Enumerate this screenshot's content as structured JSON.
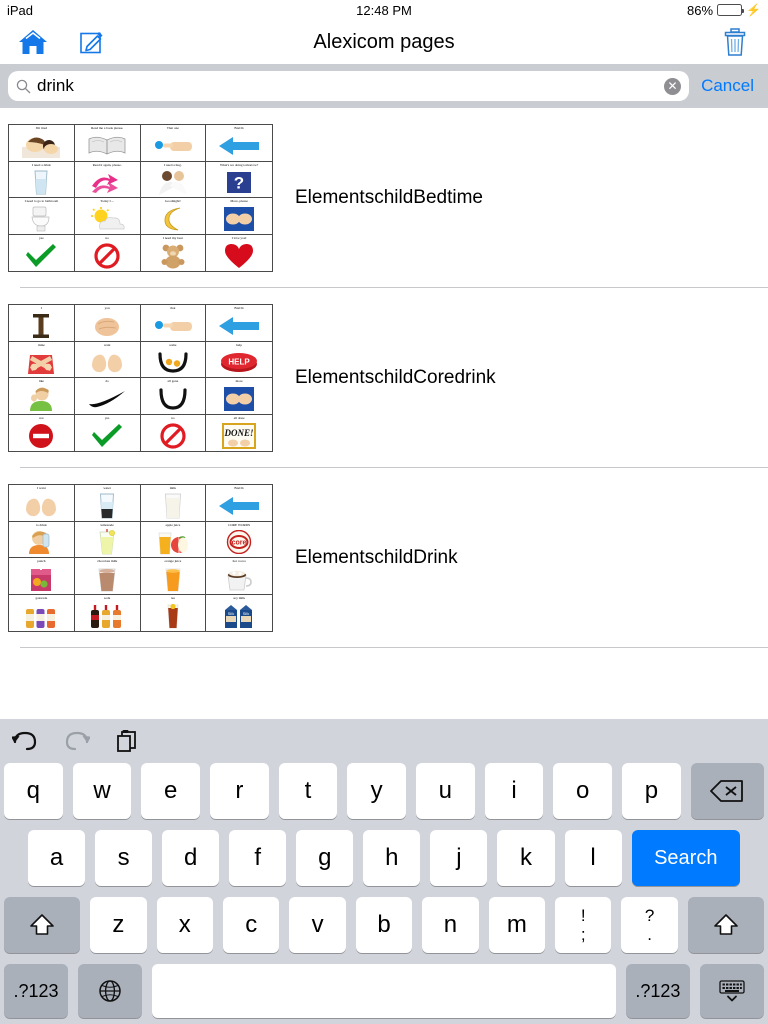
{
  "status_bar": {
    "device": "iPad",
    "time": "12:48 PM",
    "battery_percent": "86%",
    "battery_level": 86,
    "charging": true
  },
  "nav_bar": {
    "title": "Alexicom pages",
    "home_icon": "home-icon",
    "compose_icon": "compose-icon",
    "trash_icon": "trash-icon",
    "icon_color": "#1478e8"
  },
  "search": {
    "value": "drink",
    "placeholder": "Search",
    "icon": "search-icon",
    "clear_label": "✕",
    "cancel_label": "Cancel",
    "cancel_color": "#007aff",
    "bar_background": "#c9ccd1"
  },
  "results": [
    {
      "title": "ElementschildBedtime",
      "cells": [
        {
          "label": "I'm tired",
          "art": "child-sleeping"
        },
        {
          "label": "Read me a book please.",
          "art": "book"
        },
        {
          "label": "That one",
          "art": "pointing-hand"
        },
        {
          "label": "BACK",
          "art": "back-arrow"
        },
        {
          "label": "I need a drink",
          "art": "glass-water"
        },
        {
          "label": "Read it again, please.",
          "art": "pink-arrows"
        },
        {
          "label": "I need a hug.",
          "art": "hug"
        },
        {
          "label": "What's we doing tomorrow?",
          "art": "question-cube"
        },
        {
          "label": "I need to go to bathroom",
          "art": "toilet"
        },
        {
          "label": "Today I ...",
          "art": "sun-cloud"
        },
        {
          "label": "Goodnight!",
          "art": "moon"
        },
        {
          "label": "More, please",
          "art": "more-hands"
        },
        {
          "label": "yes",
          "art": "green-check"
        },
        {
          "label": "no",
          "art": "no-sign"
        },
        {
          "label": "I need my bear",
          "art": "teddy-bear"
        },
        {
          "label": "I love you!",
          "art": "red-heart"
        }
      ]
    },
    {
      "title": "ElementschildCoredrink",
      "cells": [
        {
          "label": "I",
          "art": "letter-i"
        },
        {
          "label": "you",
          "art": "pointing-fist"
        },
        {
          "label": "that",
          "art": "pointing-hand"
        },
        {
          "label": "BACK",
          "art": "back-arrow"
        },
        {
          "label": "mine",
          "art": "arms-crossed"
        },
        {
          "label": "want",
          "art": "open-hands"
        },
        {
          "label": "some",
          "art": "some-bowl"
        },
        {
          "label": "help",
          "art": "help-button"
        },
        {
          "label": "like",
          "art": "boy-like"
        },
        {
          "label": "do",
          "art": "swoosh"
        },
        {
          "label": "all gone",
          "art": "empty-bowl"
        },
        {
          "label": "more",
          "art": "more-hands"
        },
        {
          "label": "not",
          "art": "no-entry"
        },
        {
          "label": "yes",
          "art": "green-check"
        },
        {
          "label": "no",
          "art": "no-sign"
        },
        {
          "label": "all done",
          "art": "done-sign"
        }
      ]
    },
    {
      "title": "ElementschildDrink",
      "cells": [
        {
          "label": "I want",
          "art": "open-hands"
        },
        {
          "label": "water",
          "art": "glass-water"
        },
        {
          "label": "milk",
          "art": "glass-milk"
        },
        {
          "label": "BACK",
          "art": "back-arrow"
        },
        {
          "label": "to drink",
          "art": "child-drinking"
        },
        {
          "label": "lemonade",
          "art": "lemonade"
        },
        {
          "label": "apple juice",
          "art": "apple-juice"
        },
        {
          "label": "CORE WORDS",
          "art": "core-badge"
        },
        {
          "label": "punch",
          "art": "punch-box"
        },
        {
          "label": "chocolate milk",
          "art": "chocolate-milk"
        },
        {
          "label": "orange juice",
          "art": "orange-juice"
        },
        {
          "label": "hot cocoa",
          "art": "hot-cocoa"
        },
        {
          "label": "gatorade",
          "art": "gatorade"
        },
        {
          "label": "soda",
          "art": "soda-bottles"
        },
        {
          "label": "tea",
          "art": "iced-tea"
        },
        {
          "label": "soy milk",
          "art": "soy-milk"
        }
      ]
    }
  ],
  "keyboard": {
    "toolbar": [
      {
        "name": "undo-icon",
        "label": "undo",
        "enabled": true
      },
      {
        "name": "redo-icon",
        "label": "redo",
        "enabled": false
      },
      {
        "name": "paste-icon",
        "label": "paste",
        "enabled": true
      }
    ],
    "row1": [
      "q",
      "w",
      "e",
      "r",
      "t",
      "y",
      "u",
      "i",
      "o",
      "p"
    ],
    "backspace_label": "⌫",
    "row2": [
      "a",
      "s",
      "d",
      "f",
      "g",
      "h",
      "j",
      "k",
      "l"
    ],
    "search_key_label": "Search",
    "search_key_color": "#007aff",
    "row3": [
      "z",
      "x",
      "c",
      "v",
      "b",
      "n",
      "m"
    ],
    "punct_keys": [
      {
        "top": "!",
        "bottom": ";"
      },
      {
        "top": "?",
        "bottom": "."
      }
    ],
    "shift_label": "⇧",
    "num_label": ".?123",
    "globe_label": "globe-icon",
    "space_label": "",
    "hide_label": "hide-keyboard-icon",
    "key_background": "#ffffff",
    "modifier_background": "#aab0ba",
    "keyboard_background": "#d1d5db"
  }
}
